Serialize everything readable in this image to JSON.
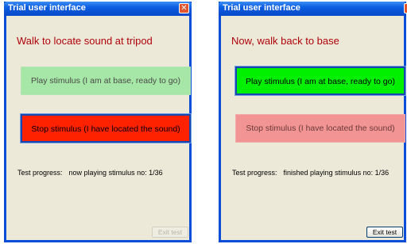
{
  "left_window": {
    "title": "Trial user interface",
    "close_glyph": "✕",
    "heading": "Walk to locate sound at tripod",
    "play_button": "Play stimulus (I am at base, ready to go)",
    "stop_button": "Stop stimulus (I have located the sound)",
    "progress_label": "Test progress:",
    "progress_status": "now playing stimulus no: 1/36",
    "exit_button": "Exit test",
    "active_button": "stop"
  },
  "right_window": {
    "title": "Trial user interface",
    "heading": "Now, walk back to base",
    "play_button": "Play stimulus (I am at base, ready to go)",
    "stop_button": "Stop stimulus (I have located the sound)",
    "progress_label": "Test progress:",
    "progress_status": "finished playing stimulus no: 1/36",
    "exit_button": "Exit test",
    "active_button": "play"
  },
  "colors": {
    "title_bar": "#0b5ee0",
    "heading": "#b0000a",
    "play_active": "#00f000",
    "play_muted": "#a6e6a6",
    "stop_active": "#ff2200",
    "stop_muted": "#f39494",
    "window_bg": "#ece9d8"
  }
}
